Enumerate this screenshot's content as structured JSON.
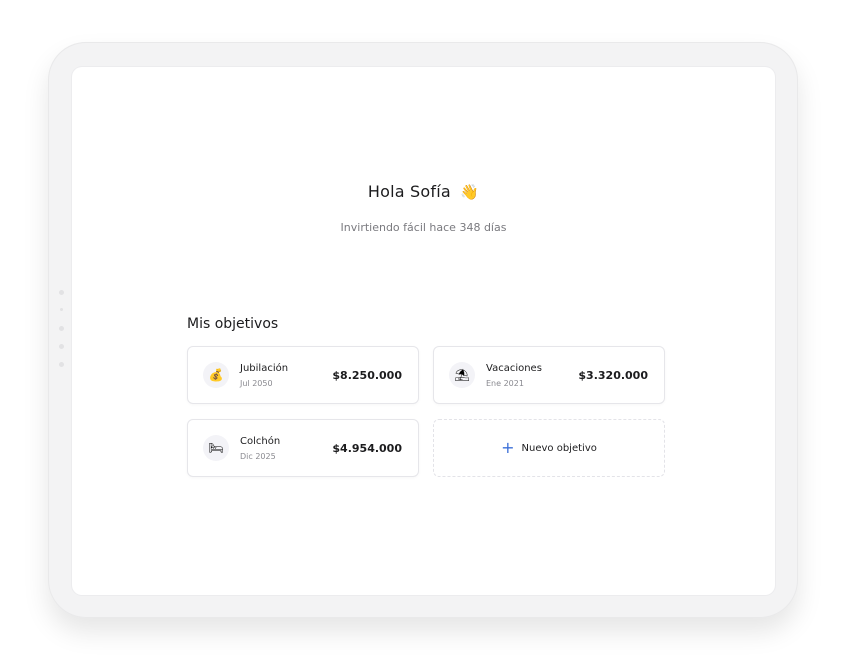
{
  "header": {
    "greeting": "Hola Sofía",
    "wave_emoji": "👋",
    "subtitle": "Invirtiendo fácil hace 348 días"
  },
  "goals": {
    "title": "Mis objetivos",
    "items": [
      {
        "name": "Jubilación",
        "date": "Jul 2050",
        "amount": "$8.250.000",
        "icon": "💰",
        "icon_name": "money-bag-icon"
      },
      {
        "name": "Vacaciones",
        "date": "Ene 2021",
        "amount": "$3.320.000",
        "icon": "⛱",
        "icon_name": "beach-umbrella-icon"
      },
      {
        "name": "Colchón",
        "date": "Dic 2025",
        "amount": "$4.954.000",
        "icon": "🛏",
        "icon_name": "bed-icon"
      }
    ],
    "add_label": "Nuevo objetivo",
    "add_icon": "+"
  },
  "colors": {
    "accent": "#3b6fd8",
    "text_primary": "#1c1c1e",
    "text_secondary": "#7a7a7f",
    "card_border": "#e6e6ea"
  }
}
